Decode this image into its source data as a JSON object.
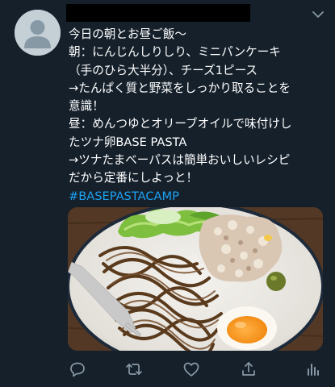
{
  "tweet": {
    "text_lines": [
      "今日の朝とお昼ご飯〜",
      "朝：にんじんしりしり、ミニパンケーキ",
      "（手のひら大半分）、チーズ1ピース",
      "→たんぱく質と野菜をしっかり取ることを",
      "意識！",
      "昼：めんつゆとオリーブオイルで味付けし",
      "たツナ卵BASE PASTA",
      "→ツナたまベーパスは簡単おいしいレシピ",
      "だから定番にしよっと！"
    ],
    "hashtag": "#BASEPASTACAMP"
  },
  "colors": {
    "background": "#15202b",
    "text": "#ffffff",
    "link": "#1da1f2",
    "icon": "#8899a6"
  },
  "icons": {
    "avatar": "default-avatar-icon",
    "caret": "chevron-down-icon",
    "reply": "reply-icon",
    "retweet": "retweet-icon",
    "like": "heart-icon",
    "share": "share-icon",
    "analytics": "analytics-icon"
  }
}
